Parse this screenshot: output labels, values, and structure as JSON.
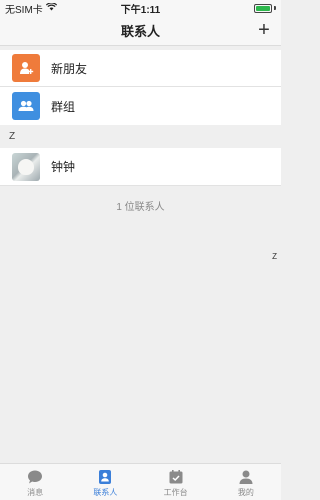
{
  "status_bar": {
    "carrier": "无SIM卡",
    "time": "下午1:11"
  },
  "nav": {
    "title": "联系人",
    "add_symbol": "+"
  },
  "special_rows": [
    {
      "label": "新朋友",
      "color": "#ef7b3b",
      "icon": "new-friend-icon"
    },
    {
      "label": "群组",
      "color": "#3f8fe0",
      "icon": "group-icon"
    }
  ],
  "section": {
    "letter": "Z"
  },
  "contacts": [
    {
      "name": "钟钟",
      "icon": "cat-photo-avatar"
    }
  ],
  "contact_count": "1 位联系人",
  "index_letter": "Z",
  "tabs": [
    {
      "label": "消息",
      "icon": "chat-icon",
      "active": false
    },
    {
      "label": "联系人",
      "icon": "contacts-icon",
      "active": true
    },
    {
      "label": "工作台",
      "icon": "calendar-icon",
      "active": false
    },
    {
      "label": "我的",
      "icon": "person-icon",
      "active": false
    }
  ],
  "colors": {
    "accent": "#3b7fd9",
    "battery": "#2db84d"
  }
}
